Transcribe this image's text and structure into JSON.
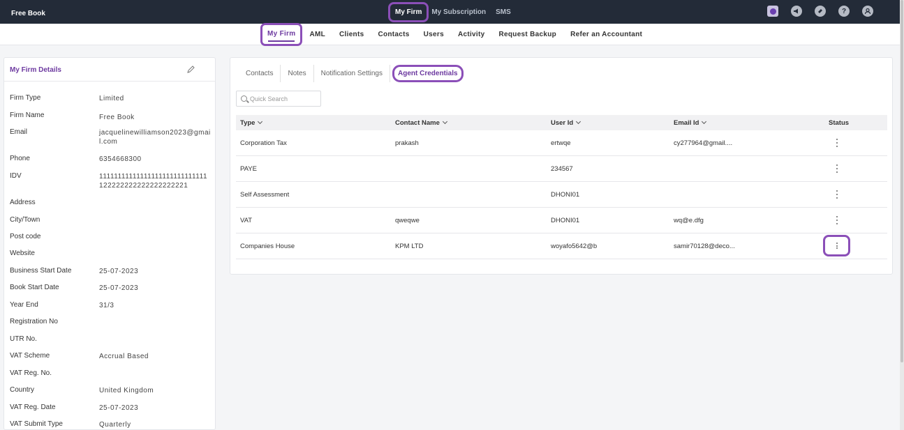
{
  "app": {
    "brand": "Free Book"
  },
  "top_nav": [
    {
      "label": "My Firm",
      "active": true
    },
    {
      "label": "My Subscription",
      "active": false
    },
    {
      "label": "SMS",
      "active": false
    }
  ],
  "top_icons": [
    "app-switcher-icon",
    "megaphone-icon",
    "ticket-icon",
    "help-icon",
    "user-icon"
  ],
  "help_glyph": "?",
  "sub_nav": [
    {
      "label": "My Firm",
      "active": true
    },
    {
      "label": "AML"
    },
    {
      "label": "Clients"
    },
    {
      "label": "Contacts"
    },
    {
      "label": "Users"
    },
    {
      "label": "Activity"
    },
    {
      "label": "Request Backup"
    },
    {
      "label": "Refer an Accountant"
    }
  ],
  "firm_details": {
    "title": "My Firm Details",
    "fields": [
      {
        "label": "Firm Type",
        "value": "Limited"
      },
      {
        "label": "Firm Name",
        "value": "Free Book"
      },
      {
        "label": "Email",
        "value": "jacquelinewilliamson2023@gmail.com"
      },
      {
        "label": "Phone",
        "value": "6354668300"
      },
      {
        "label": "IDV",
        "value": "11111111111111111111111111111122222222222222222221"
      },
      {
        "label": "Address",
        "value": ""
      },
      {
        "label": "City/Town",
        "value": ""
      },
      {
        "label": "Post code",
        "value": ""
      },
      {
        "label": "Website",
        "value": ""
      },
      {
        "label": "Business Start Date",
        "value": "25-07-2023"
      },
      {
        "label": "Book Start Date",
        "value": "25-07-2023"
      },
      {
        "label": "Year End",
        "value": "31/3"
      },
      {
        "label": "Registration No",
        "value": ""
      },
      {
        "label": "UTR No.",
        "value": ""
      },
      {
        "label": "VAT Scheme",
        "value": "Accrual Based"
      },
      {
        "label": "VAT Reg. No.",
        "value": ""
      },
      {
        "label": "Country",
        "value": "United Kingdom"
      },
      {
        "label": "VAT Reg. Date",
        "value": "25-07-2023"
      },
      {
        "label": "VAT Submit Type",
        "value": "Quarterly"
      }
    ]
  },
  "tabs": [
    {
      "label": "Contacts"
    },
    {
      "label": "Notes"
    },
    {
      "label": "Notification Settings"
    },
    {
      "label": "Agent Credentials",
      "active": true
    }
  ],
  "search": {
    "placeholder": "Quick Search",
    "value": ""
  },
  "table": {
    "columns": [
      "Type",
      "Contact Name",
      "User Id",
      "Email Id",
      "Status"
    ],
    "rows": [
      {
        "type": "Corporation Tax",
        "contact": "prakash",
        "user_id": "ertwqe",
        "email": "cy277964@gmail...."
      },
      {
        "type": "PAYE",
        "contact": "",
        "user_id": "234567",
        "email": ""
      },
      {
        "type": "Self Assessment",
        "contact": "",
        "user_id": "DHONI01",
        "email": ""
      },
      {
        "type": "VAT",
        "contact": "qweqwe",
        "user_id": "DHONI01",
        "email": "wq@e.dfg"
      },
      {
        "type": "Companies House",
        "contact": "KPM LTD",
        "user_id": "woyafo5642@b",
        "email": "samir70128@deco..."
      }
    ]
  },
  "colors": {
    "accent": "#6d3aa0",
    "highlight": "#8b4fb8",
    "topbar": "#232b38"
  }
}
